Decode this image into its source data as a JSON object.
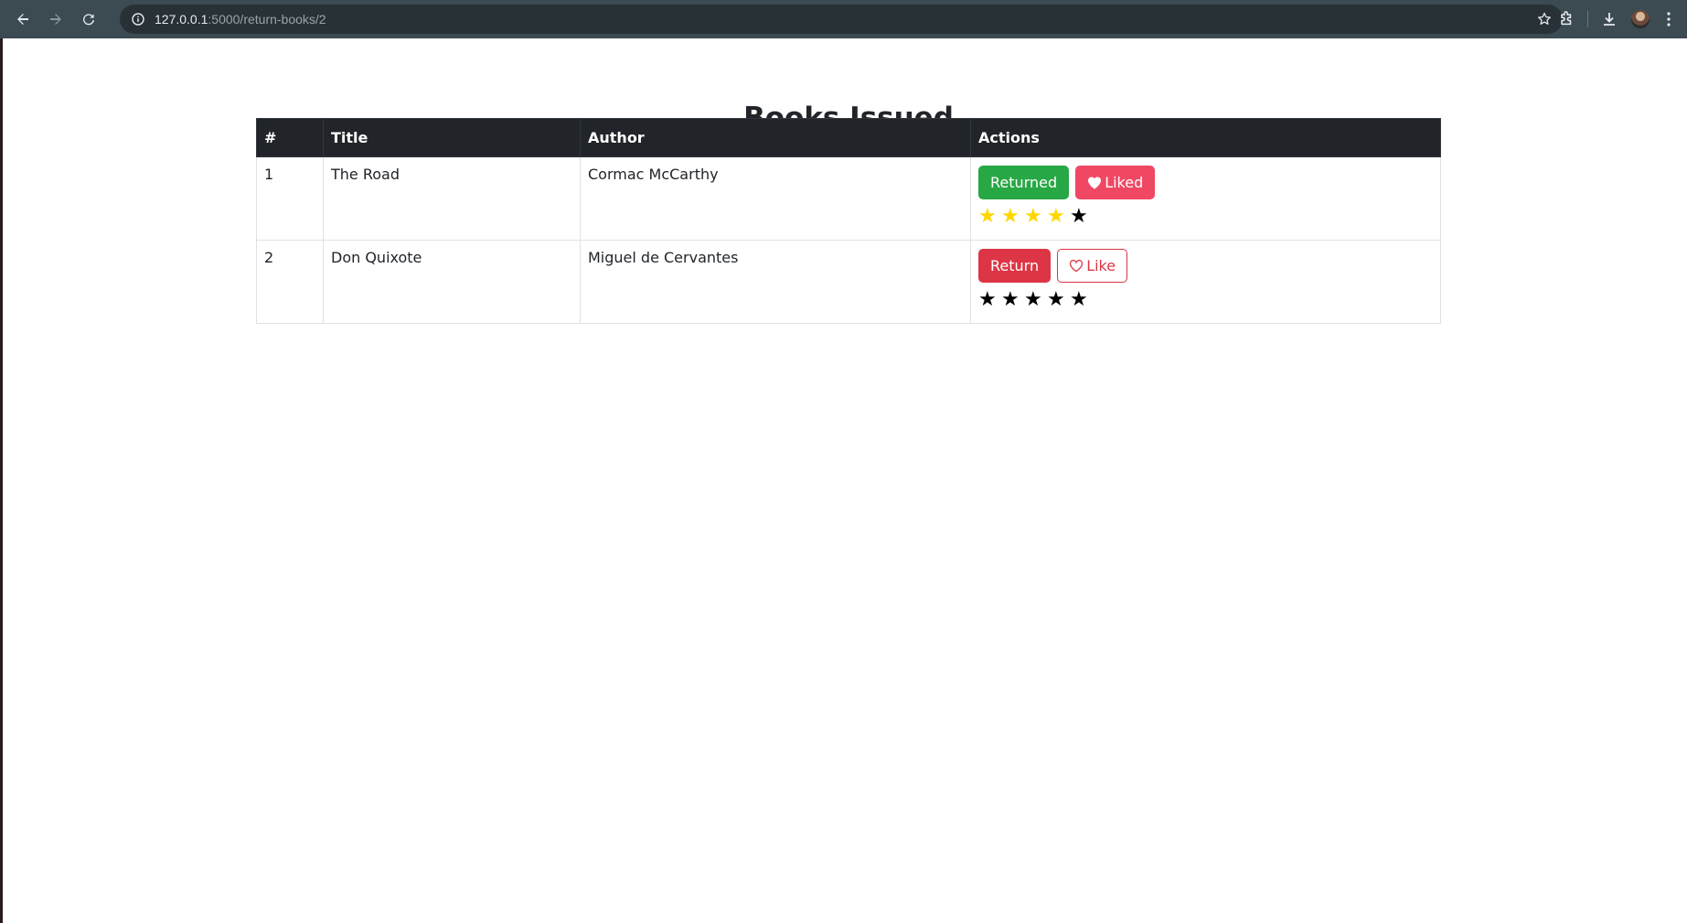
{
  "browser": {
    "url_host": "127.0.0.1",
    "url_path": ":5000/return-books/2"
  },
  "page": {
    "title": "Books Issued"
  },
  "table": {
    "headers": [
      "#",
      "Title",
      "Author",
      "Actions"
    ],
    "rows": [
      {
        "num": "1",
        "title": "The Road",
        "author": "Cormac McCarthy",
        "status_label": "Returned",
        "like_label": "Liked",
        "liked": true,
        "returned": true,
        "rating": 4,
        "rating_max": 5
      },
      {
        "num": "2",
        "title": "Don Quixote",
        "author": "Miguel de Cervantes",
        "status_label": "Return",
        "like_label": "Like",
        "liked": false,
        "returned": false,
        "rating": 0,
        "rating_max": 5
      }
    ]
  },
  "colors": {
    "star_filled": "#ffd700",
    "star_empty": "#000000",
    "success": "#28a745",
    "danger": "#dc3545",
    "liked": "#f04863"
  }
}
